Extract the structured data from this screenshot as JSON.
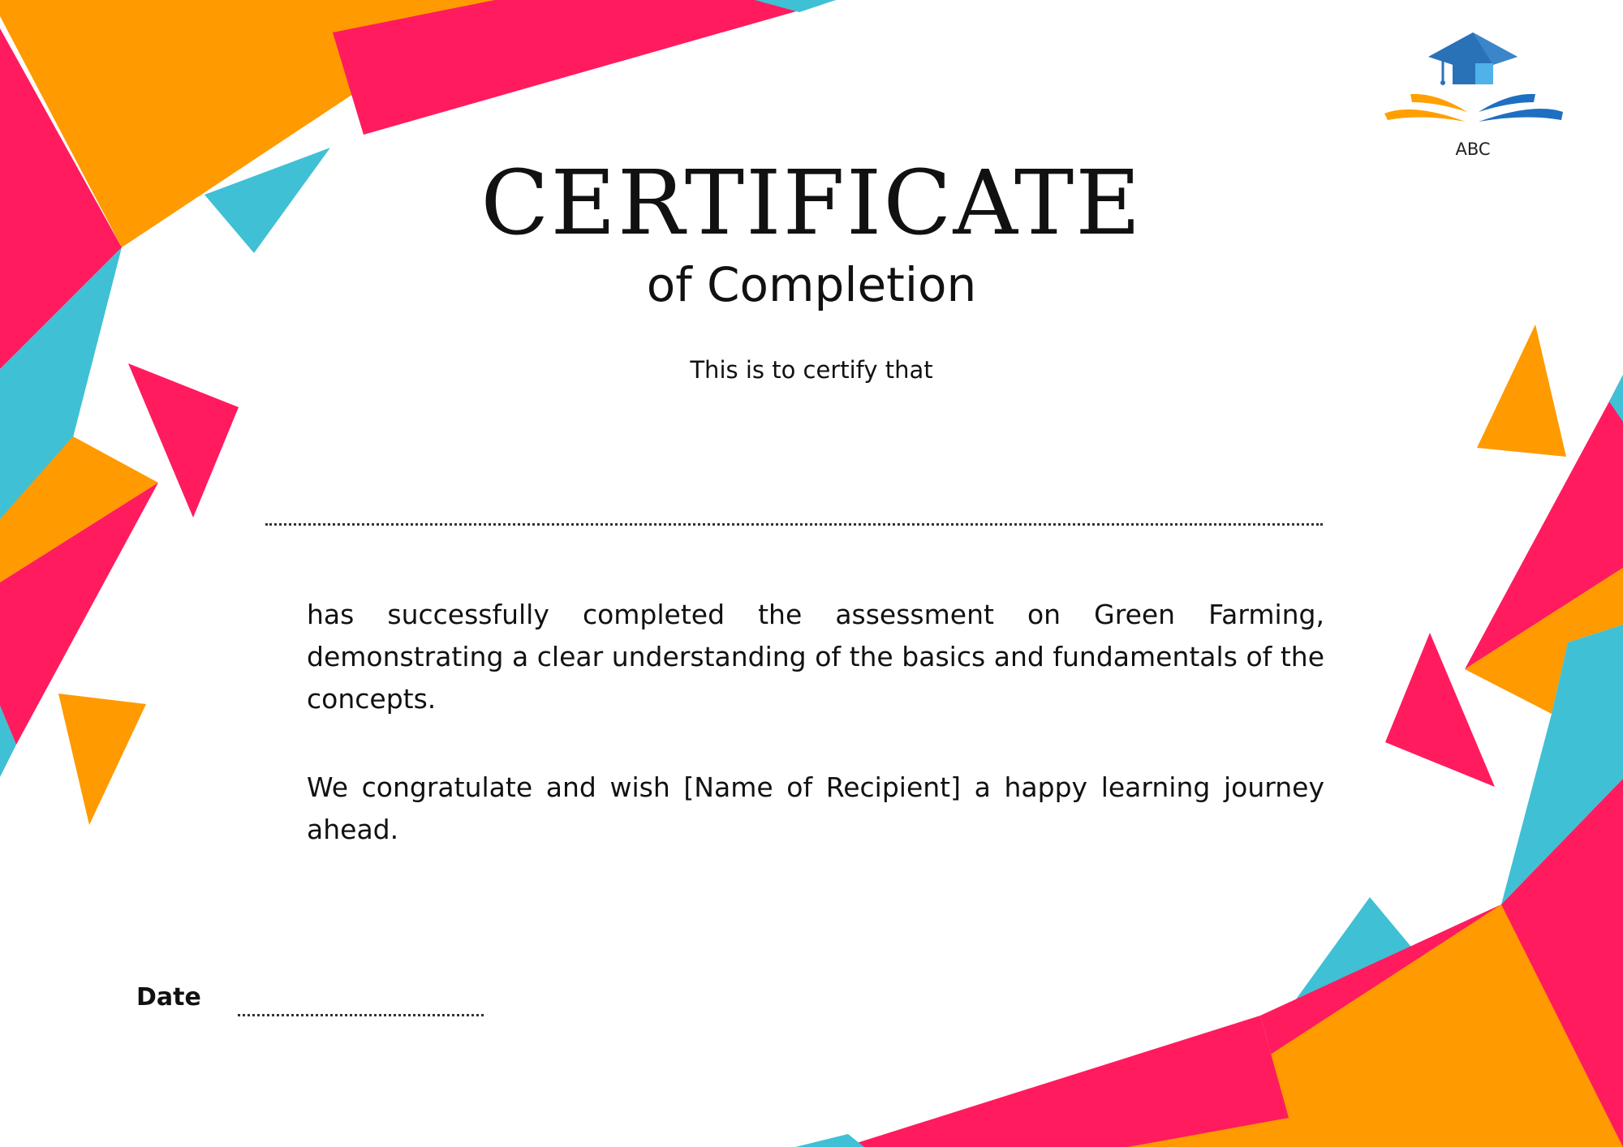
{
  "logo": {
    "text": "ABC",
    "icon": "graduation-cap-book-icon"
  },
  "certificate": {
    "title": "CERTIFICATE",
    "subtitle": "of Completion",
    "intro": "This is to certify that",
    "paragraph1": "has successfully completed the assessment on Green Farming, demonstrating a clear understanding of the basics and fundamentals of the concepts.",
    "paragraph2": "We congratulate and wish [Name of Recipient] a happy learning journey ahead.",
    "date_label": "Date"
  },
  "colors": {
    "pink": "#FF1B5E",
    "orange": "#FF9A00",
    "teal": "#40C0D4",
    "logo_blue": "#2A72B8",
    "logo_light_blue": "#4FB2E8",
    "logo_orange": "#FFA000"
  }
}
